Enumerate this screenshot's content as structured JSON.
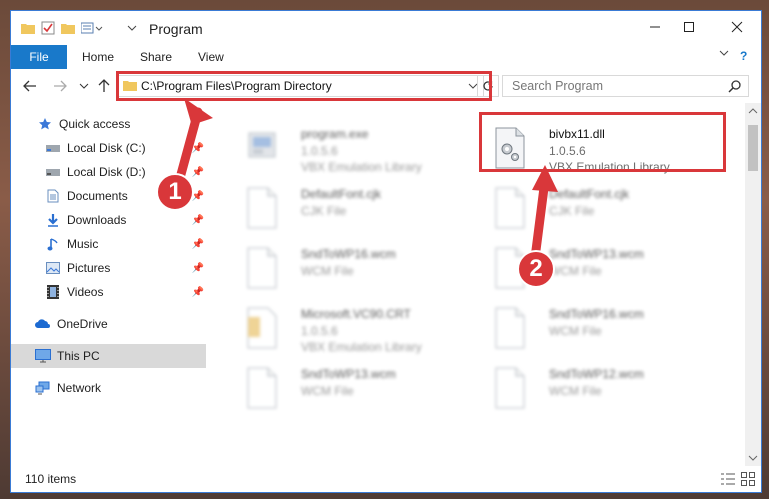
{
  "window": {
    "title": "Program"
  },
  "ribbon": {
    "tabs": [
      "File",
      "Home",
      "Share",
      "View"
    ]
  },
  "address": {
    "path": "C:\\Program Files\\Program Directory"
  },
  "search": {
    "placeholder": "Search Program"
  },
  "sidebar": {
    "items": [
      {
        "label": "Quick access",
        "icon": "star-icon"
      },
      {
        "label": "Local Disk (C:)",
        "icon": "drive-icon"
      },
      {
        "label": "Local Disk (D:)",
        "icon": "drive-icon"
      },
      {
        "label": "Documents",
        "icon": "documents-icon"
      },
      {
        "label": "Downloads",
        "icon": "downloads-icon"
      },
      {
        "label": "Music",
        "icon": "music-icon"
      },
      {
        "label": "Pictures",
        "icon": "pictures-icon"
      },
      {
        "label": "Videos",
        "icon": "videos-icon"
      },
      {
        "label": "OneDrive",
        "icon": "cloud-icon"
      },
      {
        "label": "This PC",
        "icon": "pc-icon"
      },
      {
        "label": "Network",
        "icon": "network-icon"
      }
    ]
  },
  "files": [
    {
      "name": "program.exe",
      "line1": "1.0.5.6",
      "line2": "VBX Emulation Library"
    },
    {
      "name": "bivbx11.dll",
      "line1": "1.0.5.6",
      "line2": "VBX Emulation Library"
    },
    {
      "name": "DefaultFont.cjk",
      "line1": "CJK File"
    },
    {
      "name": "DefaultFont.cjk",
      "line1": "CJK File"
    },
    {
      "name": "SndToWP16.wcm",
      "line1": "WCM File"
    },
    {
      "name": "SndToWP13.wcm",
      "line1": "WCM File"
    },
    {
      "name": "Microsoft.VC90.CRT",
      "line1": "1.0.5.6",
      "line2": "VBX Emulation Library"
    },
    {
      "name": "SndToWP16.wcm",
      "line1": "WCM File"
    },
    {
      "name": "SndToWP13.wcm",
      "line1": "WCM File"
    },
    {
      "name": "SndToWP12.wcm",
      "line1": "WCM File"
    }
  ],
  "status": {
    "count": "110 items"
  },
  "annotations": {
    "step1": "1",
    "step2": "2"
  },
  "colors": {
    "accent": "#1979ca",
    "highlight": "#d9373a",
    "selected": "#d9d9d9"
  }
}
